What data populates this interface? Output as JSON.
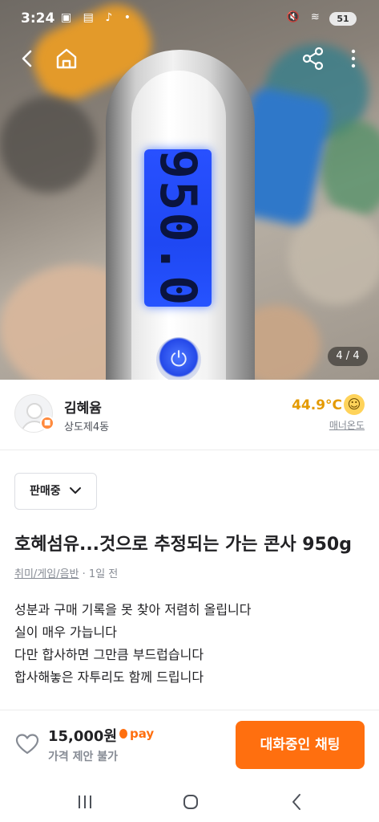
{
  "status_bar": {
    "time": "3:24",
    "left_icons": "▣ ▤ ♪ •",
    "right_icons": "🔇 ≋ ▮",
    "battery": "51"
  },
  "photo": {
    "display_reading": "950.0",
    "power_symbol": "⏻",
    "counter": "4 / 4"
  },
  "seller": {
    "name": "김혜윰",
    "location": "상도제4동",
    "temperature": "44.9°C",
    "temperature_face": "☺",
    "temperature_label": "매너온도"
  },
  "listing": {
    "status": "판매중",
    "title": "호혜섬유...것으로 추정되는 가는 콘사 950g",
    "category": "취미/게임/음반",
    "posted": " · 1일 전",
    "description": [
      "성분과 구매 기록을 못 찾아 저렴히 올립니다",
      "실이 매우 가늡니다",
      "다만 합사하면 그만큼 부드럽습니다",
      "합사해놓은 자투리도 함께 드립니다"
    ]
  },
  "bottom_bar": {
    "price": "15,000원",
    "pay": "pay",
    "negotiation": "가격 제안 불가",
    "chat_button": "대화중인 채팅"
  },
  "colors": {
    "brand": "#ff6f0f",
    "temperature": "#e49a00",
    "lcd": "#2850ff"
  },
  "icons": [
    "back-icon",
    "home-icon",
    "share-icon",
    "more-icon",
    "chevron-down-icon",
    "heart-icon",
    "recent-apps-icon",
    "system-home-icon",
    "system-back-icon"
  ]
}
